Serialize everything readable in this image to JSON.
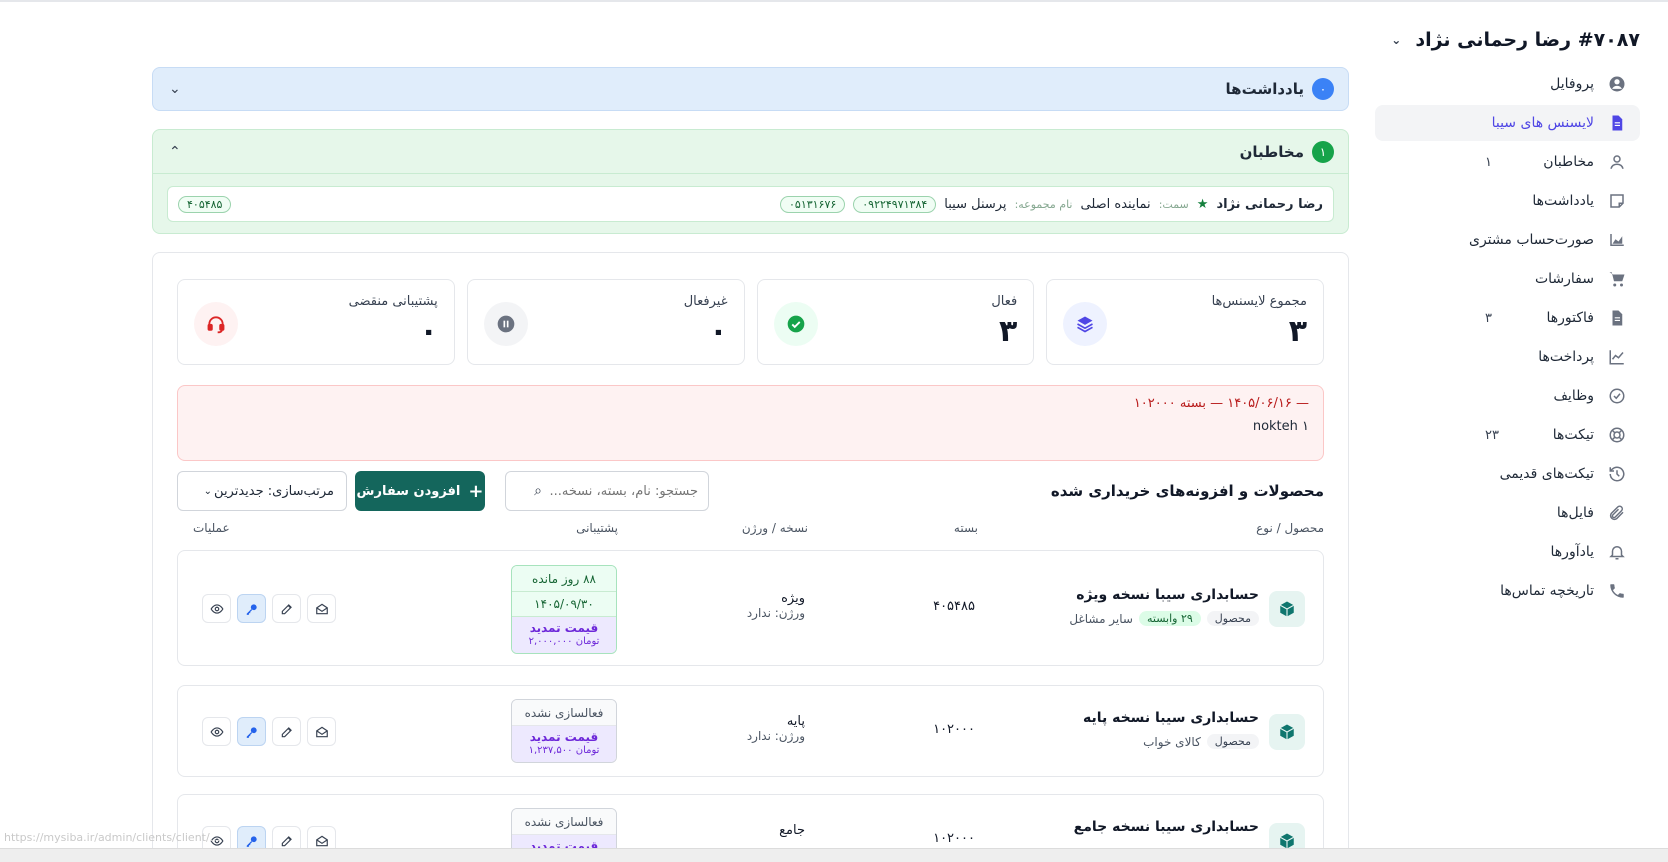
{
  "client": {
    "title": "#۷۰۸۷ رضا رحمانی نژاد"
  },
  "sidebar": {
    "items": [
      {
        "label": "پروفایل",
        "icon": "user-circle-icon",
        "badge": ""
      },
      {
        "label": "لایسنس های سیبا",
        "icon": "document-icon",
        "badge": "",
        "active": true
      },
      {
        "label": "مخاطبان",
        "icon": "person-icon",
        "badge": "۱"
      },
      {
        "label": "یادداشت‌ها",
        "icon": "note-icon",
        "badge": ""
      },
      {
        "label": "صورت‌حساب مشتری",
        "icon": "chart-area-icon",
        "badge": ""
      },
      {
        "label": "سفارشات",
        "icon": "cart-icon",
        "badge": ""
      },
      {
        "label": "فاکتورها",
        "icon": "invoice-icon",
        "badge": "۳"
      },
      {
        "label": "پرداخت‌ها",
        "icon": "line-chart-icon",
        "badge": ""
      },
      {
        "label": "وظایف",
        "icon": "check-circle-icon",
        "badge": ""
      },
      {
        "label": "تیکت‌ها",
        "icon": "lifebuoy-icon",
        "badge": "۲۳"
      },
      {
        "label": "تیکت‌های قدیمی",
        "icon": "history-icon",
        "badge": ""
      },
      {
        "label": "فایل‌ها",
        "icon": "paperclip-icon",
        "badge": ""
      },
      {
        "label": "یادآورها",
        "icon": "bell-icon",
        "badge": ""
      },
      {
        "label": "تاریخچه تماس‌ها",
        "icon": "phone-icon",
        "badge": ""
      }
    ]
  },
  "notes": {
    "title": "یادداشت‌ها",
    "count": "۰"
  },
  "contacts": {
    "title": "مخاطبان",
    "count": "۱",
    "row": {
      "name": "رضا رحمانی نژاد",
      "role_label": "سمت:",
      "role": "نماینده اصلی",
      "group_label": "نام مجموعه:",
      "group": "پرسنل سیبا",
      "mobile": "۰۹۲۲۴۹۷۱۳۸۴",
      "phone": "۰۵۱۳۱۶۷۶",
      "code": "۴۰۵۴۸۵"
    }
  },
  "stats": [
    {
      "label": "مجموع لایسنس‌ها",
      "value": "۳",
      "icon": "layers-icon",
      "color": "#4f46e5",
      "bg": "#eef2ff"
    },
    {
      "label": "فعال",
      "value": "۳",
      "icon": "check-circle-icon",
      "color": "#16a34a",
      "bg": "#ecfdf3"
    },
    {
      "label": "غیرفعال",
      "value": "۰",
      "icon": "pause-circle-icon",
      "color": "#6b7280",
      "bg": "#f3f4f6"
    },
    {
      "label": "پشتیبانی منقضی",
      "value": "۰",
      "icon": "headset-icon",
      "color": "#dc2626",
      "bg": "#fef2f2"
    }
  ],
  "alert": {
    "line1": "— ۱۴۰۵/۰۶/۱۶ — بسته ۱۰۲۰۰۰",
    "line2": "nokteh ۱"
  },
  "products": {
    "title": "محصولات و افزونه‌های خریداری شده",
    "search_placeholder": "جستجو: نام، بسته، نسخه...",
    "add_label": "افزودن سفارش",
    "sort_label": "مرتب‌سازی: جدیدترین",
    "columns": {
      "product": "محصول / نوع",
      "bundle": "بسته",
      "version": "نسخه / ورژن",
      "support": "پشتیبانی",
      "ops": "عملیات"
    },
    "rows": [
      {
        "name": "حسابداری سیبا نسخه ویژه",
        "type": "محصول",
        "related": "۲۹ وابسته",
        "category": "سایر مشاغل",
        "bundle": "۴۰۵۴۸۵",
        "edition": "ویژه",
        "version": "ورژن: ندارد",
        "days_left": "۸۸ روز مانده",
        "support_date": "۱۴۰۵/۰۹/۳۰",
        "renew_label": "قیمت تمدید",
        "renew_price": "تومان ۲,۰۰۰,۰۰۰"
      },
      {
        "name": "حسابداری سیبا نسخه پایه",
        "type": "محصول",
        "category": "کالای خواب",
        "bundle": "۱۰۲۰۰۰",
        "edition": "پایه",
        "version": "ورژن: ندارد",
        "inactive_label": "فعالسازی نشده",
        "renew_label": "قیمت تمدید",
        "renew_price": "تومان ۱,۲۳۷,۵۰۰"
      },
      {
        "name": "حسابداری سیبا نسخه جامع",
        "bundle": "۱۰۲۰۰۰",
        "edition": "جامع",
        "inactive_label": "فعالسازی نشده",
        "renew_label": "قیمت تمدید"
      }
    ]
  },
  "status_url": "https://mysiba.ir/admin/clients/client/..."
}
